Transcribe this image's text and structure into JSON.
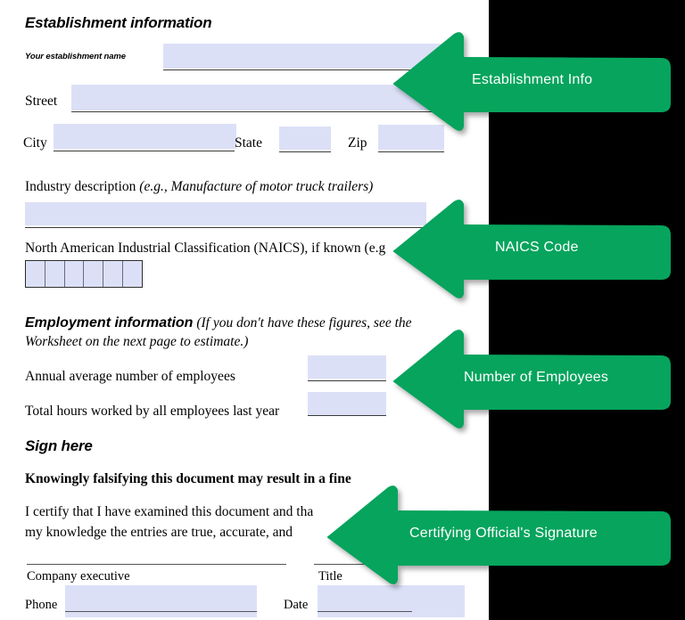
{
  "document": {
    "sections": [
      {
        "id": "establishment",
        "heading": "Establishment information"
      },
      {
        "id": "employment",
        "heading": "Employment information",
        "heading_note": "(If you don't have these figures, see the Worksheet on the next page to estimate.)"
      },
      {
        "id": "sign",
        "heading": "Sign here"
      }
    ],
    "fields": {
      "establishment_name_label": "Your establishment name",
      "street_label": "Street",
      "city_label": "City",
      "state_label": "State",
      "zip_label": "Zip",
      "industry_description_label": "Industry description",
      "industry_description_example": "(e.g., Manufacture of motor truck trailers)",
      "naics_label": "North American Industrial Classification (NAICS), if known (e.g",
      "naics_box_count": 6,
      "annual_average_employees_label": "Annual average number of employees",
      "total_hours_label": "Total hours worked by all employees last year",
      "company_executive_label": "Company executive",
      "title_label": "Title",
      "phone_label": "Phone",
      "date_label": "Date",
      "establishment_name_value": "",
      "street_value": "",
      "city_value": "",
      "state_value": "",
      "zip_value": "",
      "industry_description_value": "",
      "annual_average_employees_value": "",
      "total_hours_value": "",
      "company_executive_value": "",
      "title_value": "",
      "phone_value": "",
      "date_value": ""
    },
    "certification": {
      "warning_line": "Knowingly falsifying this document may result in a fine",
      "body_line_1": "I certify that I have examined this document and tha",
      "body_line_2": "my knowledge the entries are true, accurate, and"
    }
  },
  "callouts": [
    {
      "id": "establishment-info",
      "label": "Establishment Info"
    },
    {
      "id": "naics-code",
      "label": "NAICS Code"
    },
    {
      "id": "number-of-employees",
      "label": "Number of Employees"
    },
    {
      "id": "certifying-official-signature",
      "label": "Certifying Official's Signature"
    }
  ],
  "colors": {
    "callout_green": "#06a45d",
    "field_fill": "#dce0f7",
    "page_background": "#ffffff",
    "canvas_background": "#000000",
    "callout_label": "#ffffff"
  }
}
